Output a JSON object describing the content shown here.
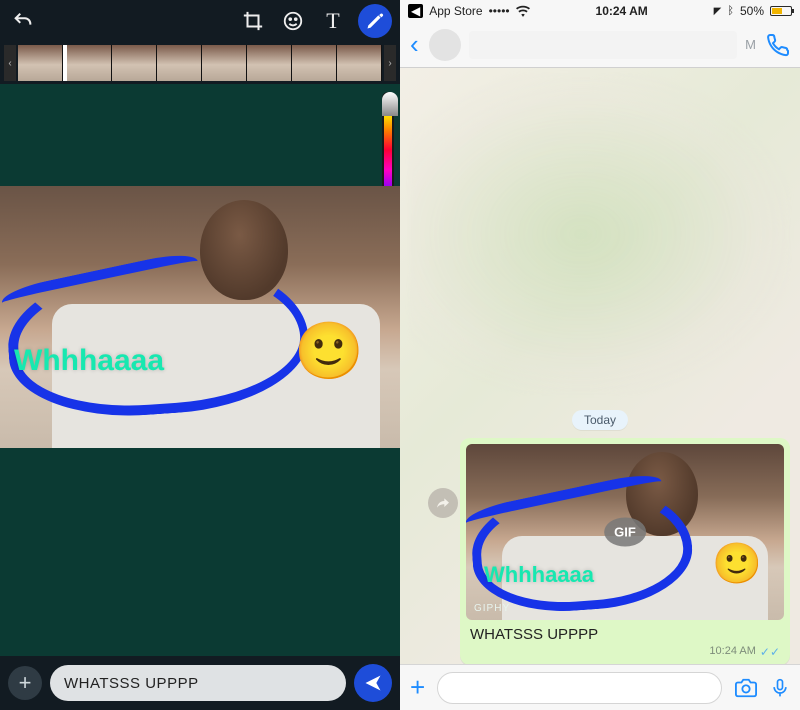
{
  "editor": {
    "toolbar": {
      "undo": "↶",
      "crop": "⤢",
      "emoji": "☺",
      "text": "T",
      "draw": "✎"
    },
    "filmstrip": {
      "left": "‹",
      "right": "›",
      "frames": 8
    },
    "overlay_text": "Whhhaaaa",
    "overlay_emoji": "🙂",
    "caption": "WHATSSS UPPPP",
    "add": "+",
    "send": "➤"
  },
  "status": {
    "back_app": "App Store",
    "signal": "•••••",
    "wifi": "ᯤ",
    "time": "10:24 AM",
    "location": "➤",
    "bt": "ᚼ",
    "battery_pct": "50%"
  },
  "chat": {
    "header": {
      "back": "‹",
      "letter": "M",
      "phone": "📞"
    },
    "divider": "Today",
    "gif_badge": "GIF",
    "gif_source": "GIPHY",
    "overlay_text": "Whhhaaaa",
    "overlay_emoji": "🙂",
    "bubble_caption": "WHATSSS UPPPP",
    "bubble_time": "10:24 AM",
    "bubble_ticks": "✓✓",
    "input": {
      "plus": "+",
      "camera": "📷",
      "mic": "🎤"
    },
    "forward": "➦"
  }
}
